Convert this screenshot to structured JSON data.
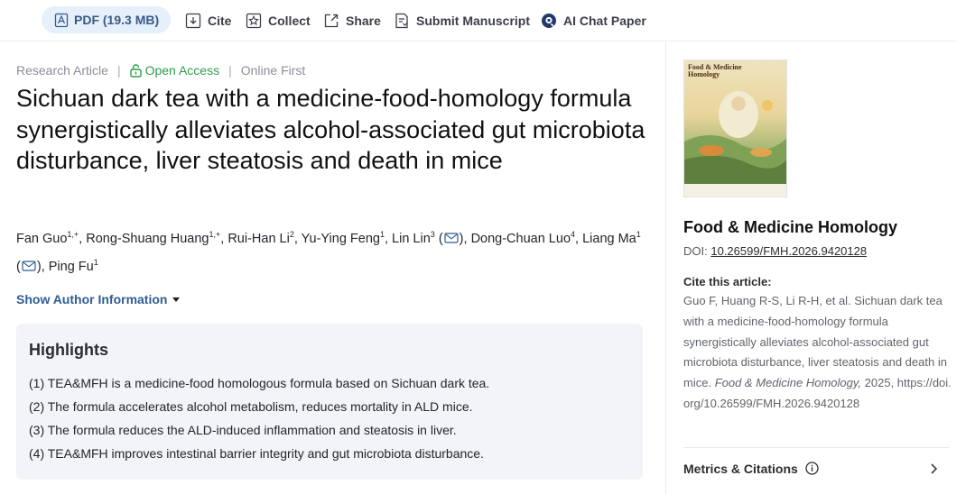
{
  "toolbar": {
    "pdf_label": "PDF (19.3 MB)",
    "cite_label": "Cite",
    "collect_label": "Collect",
    "share_label": "Share",
    "submit_label": "Submit Manuscript",
    "ai_chat_label": "AI Chat Paper"
  },
  "article": {
    "type": "Research Article",
    "access": "Open Access",
    "status": "Online First",
    "title": "Sichuan dark tea with a medicine-food-homology formula synergistically alleviates alcohol-associated gut microbiota disturbance, liver steatosis and death in mice",
    "authors": [
      {
        "name": "Fan Guo",
        "sup": "1,+",
        "email": false
      },
      {
        "name": "Rong-Shuang Huang",
        "sup": "1,+",
        "email": false
      },
      {
        "name": "Rui-Han Li",
        "sup": "2",
        "email": false
      },
      {
        "name": "Yu-Ying Feng",
        "sup": "1",
        "email": false
      },
      {
        "name": "Lin Lin",
        "sup": "3",
        "email": true
      },
      {
        "name": "Dong-Chuan Luo",
        "sup": "4",
        "email": false
      },
      {
        "name": "Liang Ma",
        "sup": "1",
        "email": true
      },
      {
        "name": "Ping Fu",
        "sup": "1",
        "email": false
      }
    ],
    "show_author_label": "Show Author Information",
    "highlights_title": "Highlights",
    "highlights": [
      "(1) TEA&MFH is a medicine-food homologous formula based on Sichuan dark tea.",
      "(2) The formula accelerates alcohol metabolism, reduces mortality in ALD mice.",
      "(3) The formula reduces the ALD-induced inflammation and steatosis in liver.",
      "(4) TEA&MFH improves intestinal barrier integrity and gut microbiota disturbance."
    ]
  },
  "sidebar": {
    "cover_title": "Food & Medicine Homology",
    "journal_name": "Food & Medicine Homology",
    "doi_prefix": "DOI:",
    "doi_value": "10.26599/FMH.2026.9420128",
    "cite_label": "Cite this article:",
    "cite_text_plain": "Guo F, Huang R-S, Li R-H, et al. Sichuan dark tea with a medicine-food-homology formula synergistically alleviates alcohol-associated gut microbiota disturbance, liver steatosis and death in mice.",
    "cite_journal_italic": "Food & Medicine Homology,",
    "cite_text_tail": "2025, https://doi.org/10.26599/FMH.2026.9420128",
    "metrics_label": "Metrics & Citations"
  },
  "colors": {
    "link_blue": "#2f5d94",
    "open_access_green": "#2e9d4d",
    "pdf_button_bg": "#e5f0fb",
    "highlights_bg": "#f2f4f7"
  },
  "icons": [
    "pdf-icon",
    "cite-icon",
    "collect-icon",
    "share-icon",
    "submit-icon",
    "ai-chat-icon",
    "lock-icon",
    "email-icon",
    "caret-down-icon",
    "info-icon",
    "chevron-right-icon"
  ]
}
